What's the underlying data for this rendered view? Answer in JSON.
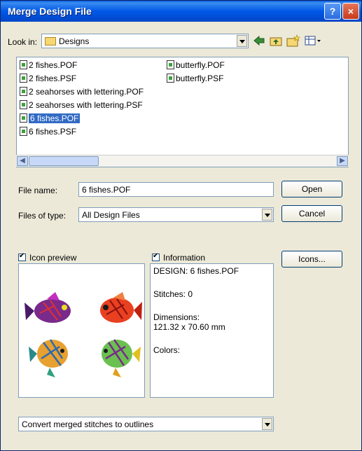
{
  "window": {
    "title": "Merge Design File",
    "help_label": "?",
    "close_label": "×"
  },
  "lookin": {
    "label": "Look in:",
    "value": "Designs"
  },
  "toolbar_icons": [
    "back-arrow-icon",
    "up-folder-icon",
    "new-folder-icon",
    "view-menu-icon"
  ],
  "files": [
    {
      "name": "2 fishes.POF",
      "selected": false
    },
    {
      "name": "2 fishes.PSF",
      "selected": false
    },
    {
      "name": "2 seahorses with lettering.POF",
      "selected": false
    },
    {
      "name": "2 seahorses with lettering.PSF",
      "selected": false
    },
    {
      "name": "6 fishes.POF",
      "selected": true
    },
    {
      "name": "6 fishes.PSF",
      "selected": false
    },
    {
      "name": "butterfly.POF",
      "selected": false
    },
    {
      "name": "butterfly.PSF",
      "selected": false
    }
  ],
  "filename": {
    "label": "File name:",
    "value": "6 fishes.POF"
  },
  "filetype": {
    "label": "Files of type:",
    "value": "All Design Files"
  },
  "buttons": {
    "open": "Open",
    "cancel": "Cancel",
    "icons": "Icons..."
  },
  "icon_preview": {
    "label": "Icon preview",
    "checked": true
  },
  "information": {
    "label": "Information",
    "checked": true,
    "design": "DESIGN:  6 fishes.POF",
    "stitches": "Stitches:  0",
    "dimensions_label": "Dimensions:",
    "dimensions_value": "121.32 x 70.60 mm",
    "colors": "Colors:"
  },
  "convert": {
    "value": "Convert merged stitches to outlines"
  },
  "colors": {
    "titlebar": "#0058e6",
    "selection": "#316ac5",
    "dialog_bg": "#ece9d8"
  }
}
